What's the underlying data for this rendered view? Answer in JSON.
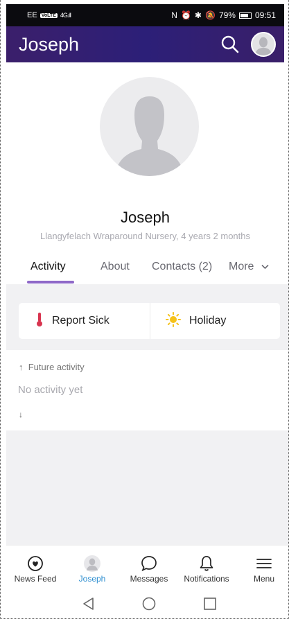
{
  "status_bar": {
    "carrier": "EE",
    "volte": "VoLTE",
    "network": "4G",
    "battery": "79%",
    "time": "09:51"
  },
  "app_bar": {
    "title": "Joseph"
  },
  "profile": {
    "name": "Joseph",
    "subtitle": "Llangyfelach Wraparound Nursery, 4 years 2 months"
  },
  "tabs": [
    {
      "label": "Activity",
      "active": true
    },
    {
      "label": "About"
    },
    {
      "label": "Contacts (2)"
    },
    {
      "label": "More"
    }
  ],
  "actions": {
    "report_sick": "Report Sick",
    "holiday": "Holiday"
  },
  "timeline": {
    "future": "Future activity",
    "empty": "No activity yet",
    "up_arrow": "↑",
    "down_arrow": "↓"
  },
  "bottom_nav": [
    {
      "label": "News Feed",
      "icon": "news-feed-icon"
    },
    {
      "label": "Joseph",
      "icon": "child-avatar-icon",
      "active": true
    },
    {
      "label": "Messages",
      "icon": "speech-bubble-icon"
    },
    {
      "label": "Notifications",
      "icon": "bell-icon"
    },
    {
      "label": "Menu",
      "icon": "hamburger-icon"
    }
  ],
  "colors": {
    "header": "#2c1f78",
    "tab_indicator": "#8e68c8",
    "active_nav": "#2f8fd0",
    "background": "#f1f1f3"
  }
}
